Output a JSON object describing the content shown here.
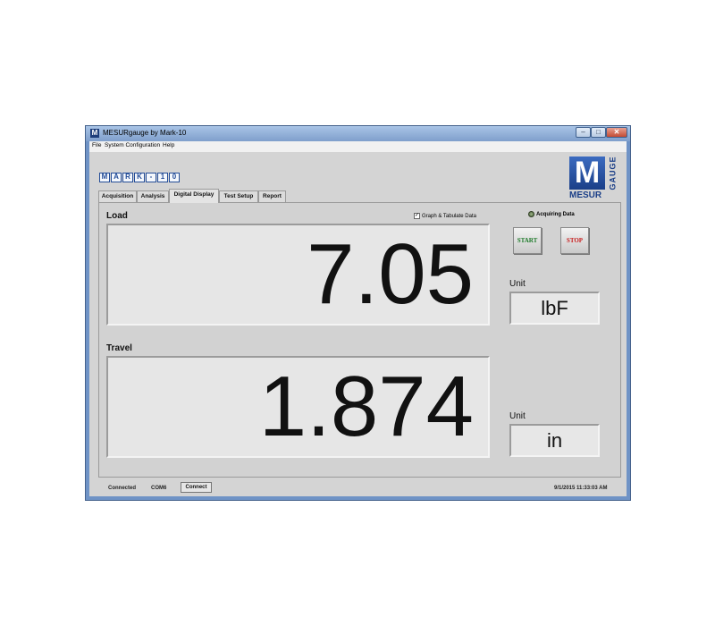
{
  "window": {
    "title": "MESURgauge by Mark-10",
    "icon_letter": "M",
    "controls": {
      "minimize": "–",
      "maximize": "□",
      "close": "✕"
    }
  },
  "menu": [
    "File",
    "System Configuration",
    "Help"
  ],
  "logo": {
    "mark_letters": [
      "M",
      "A",
      "R",
      "K",
      "-",
      "1",
      "0"
    ],
    "mesur_letter": "M",
    "mesur_word": "MESUR",
    "gauge_word": "GAUGE",
    "brand_color": "#244d98"
  },
  "tabs": [
    {
      "label": "Acquisition",
      "active": false
    },
    {
      "label": "Analysis",
      "active": false
    },
    {
      "label": "Digital Display",
      "active": true
    },
    {
      "label": "Test Setup",
      "active": false
    },
    {
      "label": "Report",
      "active": false
    }
  ],
  "load": {
    "label": "Load",
    "value": "7.05",
    "unit_label": "Unit",
    "unit": "lbF"
  },
  "travel": {
    "label": "Travel",
    "value": "1.874",
    "unit_label": "Unit",
    "unit": "in"
  },
  "graph_tabulate": {
    "label": "Graph & Tabulate Data",
    "checked": true,
    "check_glyph": "✓"
  },
  "acquiring": {
    "label": "Acquiring Data",
    "led_color": "#6f8a58"
  },
  "buttons": {
    "start": "START",
    "stop": "STOP",
    "start_color": "#1e7a2a",
    "stop_color": "#c82020"
  },
  "status": {
    "connection": "Connected",
    "port": "COM6",
    "connect_button": "Connect",
    "datetime": "9/1/2015 11:33:03 AM"
  }
}
